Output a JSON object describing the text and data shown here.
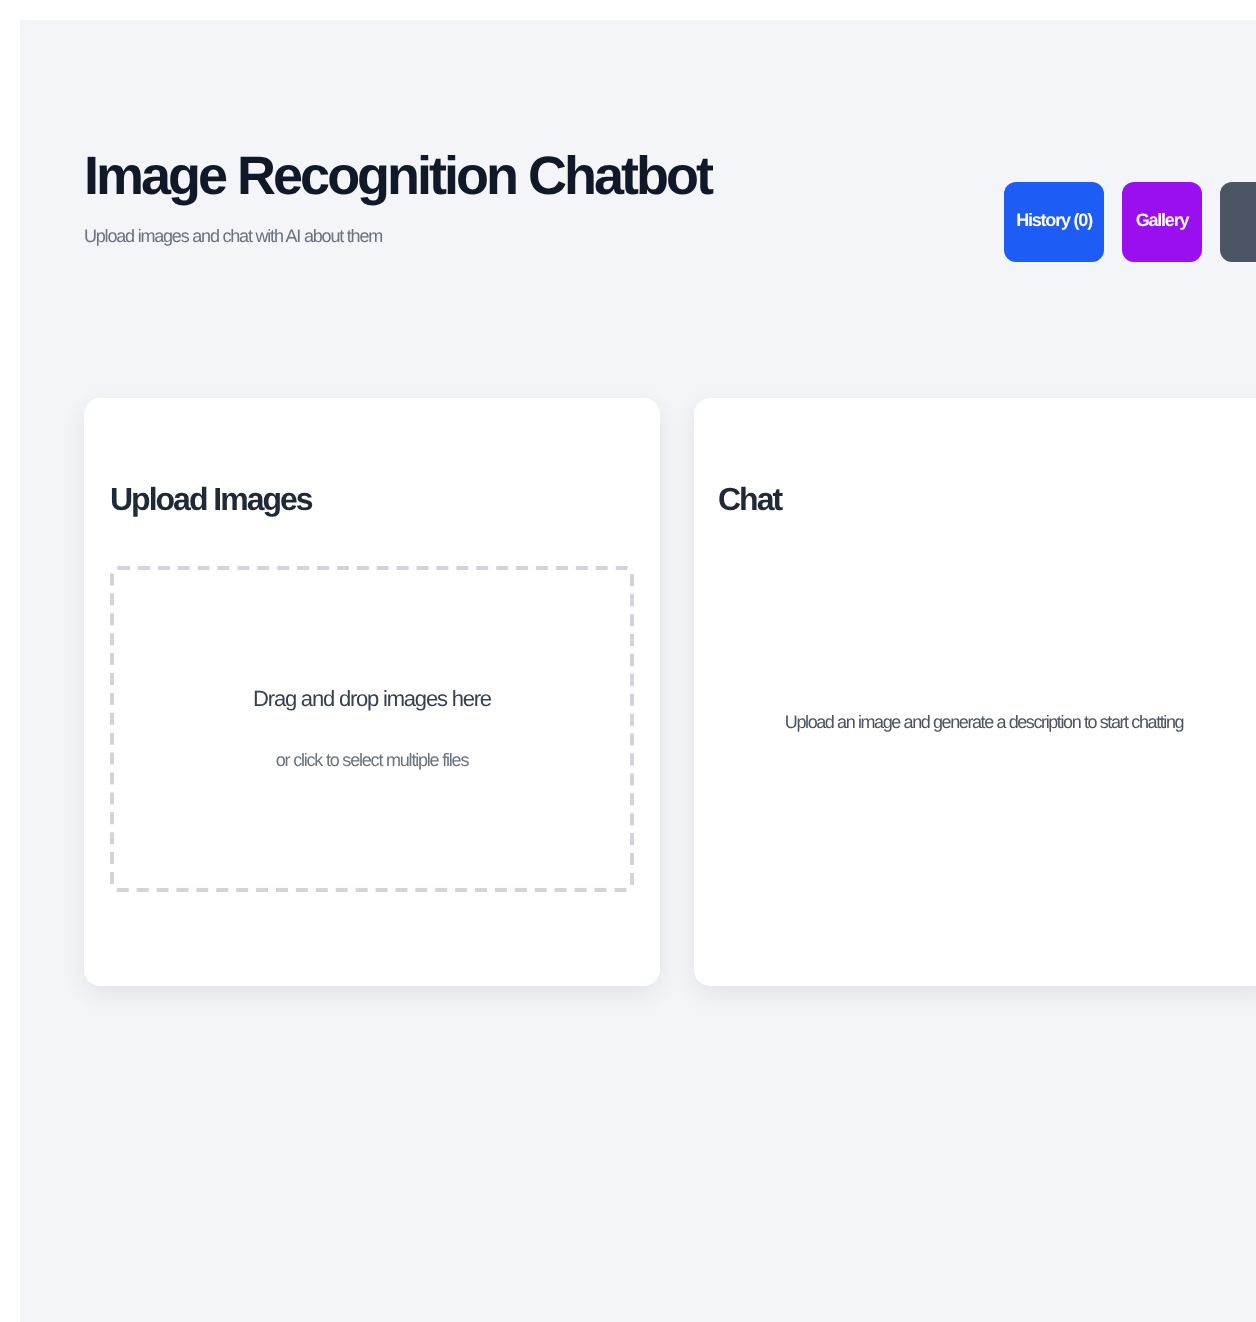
{
  "header": {
    "title": "Image Recognition Chatbot",
    "subtitle": "Upload images and chat with AI about them"
  },
  "buttons": [
    {
      "label": "History (0)",
      "color": "#1d5cf5"
    },
    {
      "label": "Gallery",
      "color": "#9a0ff0"
    },
    {
      "color": "#4b5563"
    }
  ],
  "upload_card": {
    "title": "Upload Images",
    "drop_text": "Drag and drop images here",
    "hint": "or click to select multiple files"
  },
  "chat_card": {
    "title": "Chat",
    "empty_text": "Upload an image and generate a description to start chatting"
  }
}
